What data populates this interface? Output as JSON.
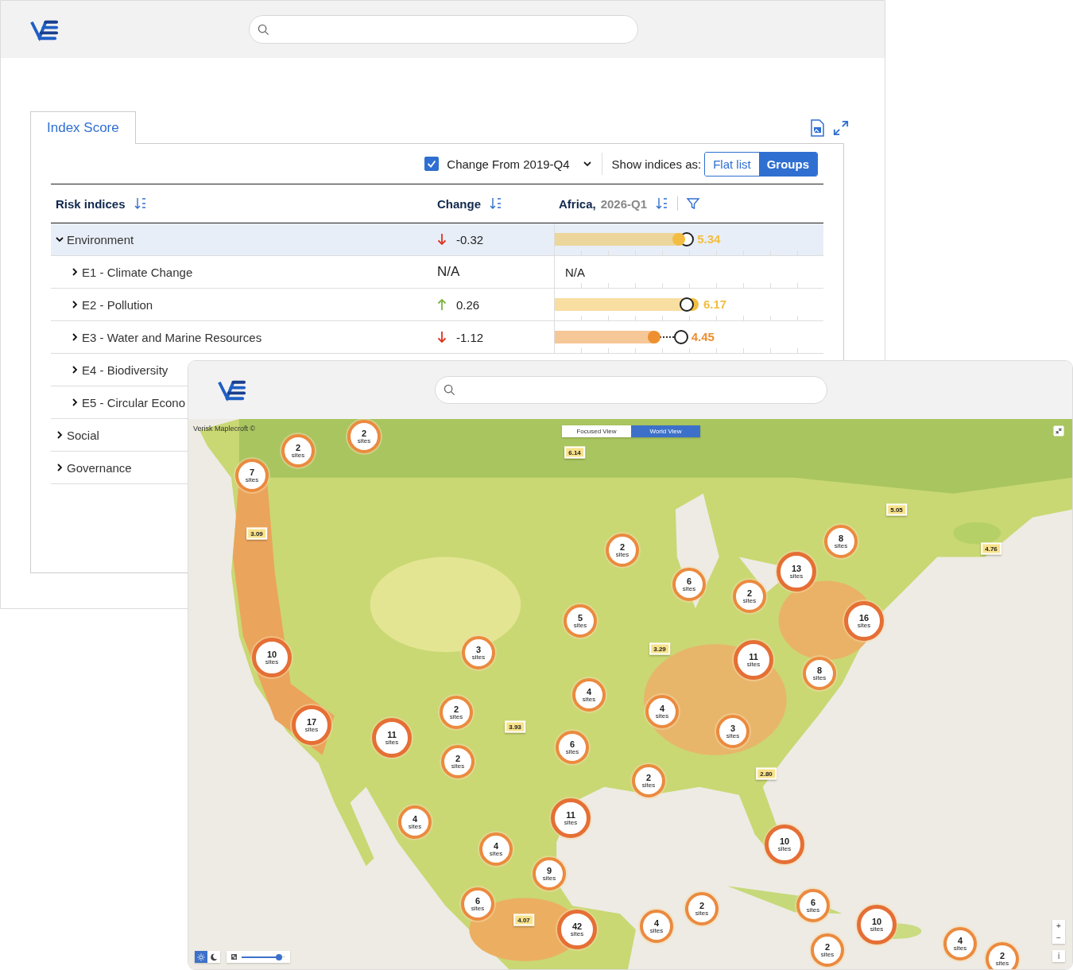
{
  "back_window": {
    "tabs": [
      {
        "label": "Index Score",
        "selected": true
      }
    ],
    "change_from": {
      "checked": true,
      "label": "Change From 2019-Q4"
    },
    "show_as": {
      "label": "Show indices as:",
      "options": [
        {
          "label": "Flat list",
          "selected": false
        },
        {
          "label": "Groups",
          "selected": true
        }
      ]
    },
    "table": {
      "columns": [
        {
          "label": "Risk indices"
        },
        {
          "label": "Change"
        },
        {
          "label": "Africa,",
          "sublabel": "2026-Q1"
        }
      ],
      "rows": [
        {
          "name": "Environment",
          "expanded": true,
          "selected": true,
          "change": "-0.32",
          "score": "5.34",
          "level": 0.46,
          "color": "#f2bd42",
          "children": [
            {
              "name": "E1 - Climate Change",
              "expanded": false,
              "selected": false,
              "change": "N/A",
              "score": "N/A"
            },
            {
              "name": "E2 - Pollution",
              "expanded": false,
              "selected": false,
              "change": "0.26",
              "score": "6.17",
              "level": 0.51,
              "color": "#f2bd42"
            },
            {
              "name": "E3 - Water and Marine Resources",
              "expanded": false,
              "selected": false,
              "change": "-1.12",
              "score": "4.45",
              "level": 0.37,
              "color": "#ee8f30"
            },
            {
              "name": "E4 - Biodiversity",
              "expanded": false,
              "selected": false
            },
            {
              "name": "E5 - Circular Econo",
              "expanded": false,
              "selected": false
            }
          ]
        },
        {
          "name": "Social",
          "expanded": false,
          "selected": false
        },
        {
          "name": "Governance",
          "expanded": false,
          "selected": false
        }
      ]
    }
  },
  "map_window": {
    "attribution": "Verisk Maplecroft ©",
    "view_toggle": [
      {
        "label": "Focused View",
        "selected": false
      },
      {
        "label": "World View",
        "selected": true
      }
    ],
    "clusters": [
      {
        "count": "2",
        "unit": "sites"
      },
      {
        "count": "2",
        "unit": "sites"
      },
      {
        "count": "7",
        "unit": "sites"
      },
      {
        "count": "2",
        "unit": "sites"
      },
      {
        "count": "8",
        "unit": "sites"
      },
      {
        "count": "13",
        "unit": "sites"
      },
      {
        "count": "6",
        "unit": "sites"
      },
      {
        "count": "2",
        "unit": "sites"
      },
      {
        "count": "5",
        "unit": "sites"
      },
      {
        "count": "16",
        "unit": "sites"
      },
      {
        "count": "10",
        "unit": "sites"
      },
      {
        "count": "3",
        "unit": "sites"
      },
      {
        "count": "11",
        "unit": "sites"
      },
      {
        "count": "8",
        "unit": "sites"
      },
      {
        "count": "4",
        "unit": "sites"
      },
      {
        "count": "4",
        "unit": "sites"
      },
      {
        "count": "17",
        "unit": "sites"
      },
      {
        "count": "11",
        "unit": "sites"
      },
      {
        "count": "2",
        "unit": "sites"
      },
      {
        "count": "3",
        "unit": "sites"
      },
      {
        "count": "6",
        "unit": "sites"
      },
      {
        "count": "2",
        "unit": "sites"
      },
      {
        "count": "2",
        "unit": "sites"
      },
      {
        "count": "11",
        "unit": "sites"
      },
      {
        "count": "4",
        "unit": "sites"
      },
      {
        "count": "10",
        "unit": "sites"
      },
      {
        "count": "4",
        "unit": "sites"
      },
      {
        "count": "9",
        "unit": "sites"
      },
      {
        "count": "6",
        "unit": "sites"
      },
      {
        "count": "42",
        "unit": "sites"
      },
      {
        "count": "4",
        "unit": "sites"
      },
      {
        "count": "2",
        "unit": "sites"
      },
      {
        "count": "6",
        "unit": "sites"
      },
      {
        "count": "10",
        "unit": "sites"
      },
      {
        "count": "2",
        "unit": "sites"
      },
      {
        "count": "4",
        "unit": "sites"
      },
      {
        "count": "2",
        "unit": "sites"
      }
    ],
    "price_tags": [
      "6.14",
      "5.05",
      "3.09",
      "4.76",
      "3.29",
      "3.93",
      "2.80",
      "4.07"
    ],
    "theme": [
      {
        "kind": "light",
        "selected": true
      },
      {
        "kind": "dark",
        "selected": false
      }
    ],
    "opacity_slider": {
      "level": 0.85
    },
    "zoom_buttons": [
      "+",
      "−"
    ],
    "info_button": "i"
  }
}
